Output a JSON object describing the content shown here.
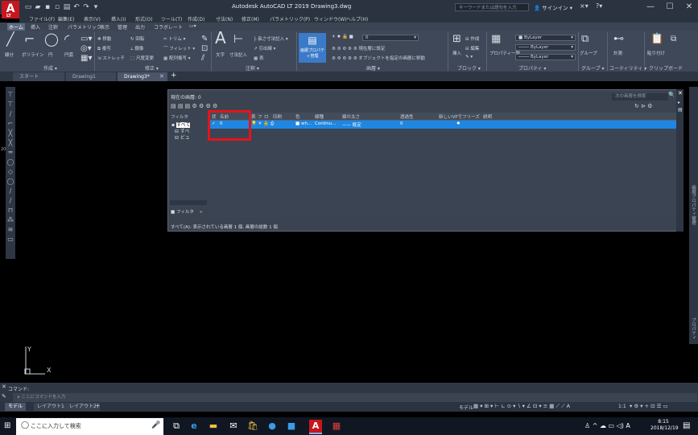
{
  "window": {
    "title": "Autodesk AutoCAD LT 2019    Drawing3.dwg",
    "search_placeholder": "キーワードまたは語句を入力",
    "signin": "サインイン",
    "logo_sub": "LT"
  },
  "menubar": [
    "ファイル(F)",
    "編集(E)",
    "表示(V)",
    "挿入(I)",
    "形式(O)",
    "ツール(T)",
    "作成(D)",
    "寸法(N)",
    "修正(M)",
    "パラメトリック(P)",
    "ウィンドウ(W)",
    "ヘルプ(H)"
  ],
  "ribbon_tabs": [
    "ホーム",
    "挿入",
    "注釈",
    "パラメトリック",
    "表示",
    "管理",
    "出力",
    "コラボレート"
  ],
  "ribbon": {
    "draw": {
      "label": "作成",
      "tools": [
        "線分",
        "ポリライン",
        "円",
        "円弧"
      ]
    },
    "modify": {
      "label": "修正",
      "tools": [
        "移動",
        "回転",
        "トリム",
        "複写",
        "鏡像",
        "フィレット",
        "ストレッチ",
        "尺度変更",
        "配列複写"
      ]
    },
    "annotation": {
      "label": "注釈",
      "tools": [
        "文字",
        "寸法記入",
        "長さ寸法記入",
        "引出線",
        "表"
      ]
    },
    "layers": {
      "label": "画層",
      "button": "画層プロパティ管理",
      "current_layer": "0",
      "items": [
        "現在層に設定",
        "オブジェクトを指定の画層に移動"
      ]
    },
    "block": {
      "label": "ブロック",
      "items": [
        "挿入",
        "作成",
        "編集"
      ]
    },
    "properties": {
      "label": "プロパティ",
      "color": "ByLayer",
      "linetype": "ByLayer",
      "lineweight": "ByLayer",
      "button": "プロパティ一致"
    },
    "groups": {
      "label": "グループ",
      "button": "グループ"
    },
    "utilities": {
      "label": "ユーティリティ",
      "button": "計測"
    },
    "clipboard": {
      "label": "クリップボード",
      "button": "貼り付け"
    }
  },
  "doc_tabs": [
    "スタート",
    "Drawing1",
    "Drawing3*"
  ],
  "layer_palette": {
    "current_layer": "現在の画層: 0",
    "search_placeholder": "次の画層を検索",
    "filter_label": "フィルタ",
    "filter_tree": [
      "すべて",
      "すべ",
      "ビュ"
    ],
    "columns": [
      "状",
      "名前",
      "表",
      "フ",
      "ロ",
      "印刷",
      "色",
      "線種",
      "線の太さ",
      "透過性",
      "新しいVPでフリーズ",
      "説明"
    ],
    "rows": [
      {
        "status": "✓",
        "name": "0",
        "color": "wh...",
        "linetype": "Continu...",
        "lineweight": "—— 既定",
        "transparency": "0"
      }
    ],
    "invert_filter": "フィルタ",
    "footer": "すべて(A): 表示されている画層 1 個, 画層の総数 1 個"
  },
  "side_labels": {
    "palette_title": "画層プロパティ管理",
    "props": "プロパティ"
  },
  "ruler_number": "20",
  "command": {
    "label": "コマンド:",
    "placeholder": "ここにコマンドを入力"
  },
  "layout_tabs": [
    "モデル",
    "レイアウト1",
    "レイアウト2"
  ],
  "status_right": {
    "model": "モデル",
    "scale": "1:1"
  },
  "taskbar": {
    "search": "ここに入力して検索",
    "time": "8:15",
    "date": "2018/12/19",
    "ime": "A"
  }
}
